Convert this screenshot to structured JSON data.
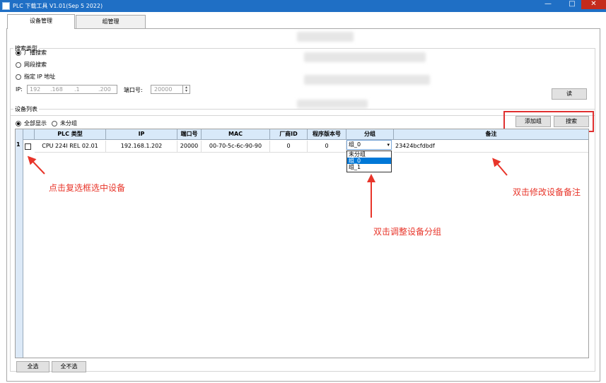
{
  "window": {
    "title": "PLC 下载工具 V1.01(Sep  5 2022)",
    "min_glyph": "—",
    "max_glyph": "□",
    "close_glyph": "✕",
    "accent": "#1f6fc5"
  },
  "tabs": [
    {
      "label": "设备管理",
      "active": true
    },
    {
      "label": "组管理",
      "active": false
    }
  ],
  "search_type": {
    "title": "搜索类型",
    "options": [
      {
        "label": "广播搜索",
        "selected": true
      },
      {
        "label": "网段搜索",
        "selected": false
      },
      {
        "label": "指定 IP 地址",
        "selected": false
      }
    ],
    "ip_label": "IP:",
    "ip_octets": [
      "192",
      ".168",
      ".1",
      ".200"
    ],
    "port_label": "端口号:",
    "port_value": "20000",
    "read_button": "读"
  },
  "device_list": {
    "title": "设备列表",
    "filters": [
      {
        "label": "全部显示",
        "selected": true
      },
      {
        "label": "未分组",
        "selected": false
      }
    ],
    "add_group_button": "添加组",
    "search_button": "搜索",
    "columns": [
      "PLC 类型",
      "IP",
      "端口号",
      "MAC",
      "厂商ID",
      "程序版本号",
      "分组",
      "备注"
    ],
    "rows": [
      {
        "index": "1",
        "checked": false,
        "cells": [
          "CPU 224I REL 02.01",
          "192.168.1.202",
          "20000",
          "00-70-5c-6c-90-90",
          "0",
          "0"
        ],
        "group": "组_0",
        "remark": "23424bcfdbdf"
      }
    ],
    "group_options": [
      "未分组",
      "组_0",
      "组_1"
    ],
    "group_selected_index": 1
  },
  "bottom_buttons": {
    "select_all": "全选",
    "select_none": "全不选"
  },
  "annotations": {
    "checkbox_hint": "点击复选框选中设备",
    "group_hint": "双击调整设备分组",
    "remark_hint": "双击修改设备备注",
    "color": "#e8352a"
  }
}
